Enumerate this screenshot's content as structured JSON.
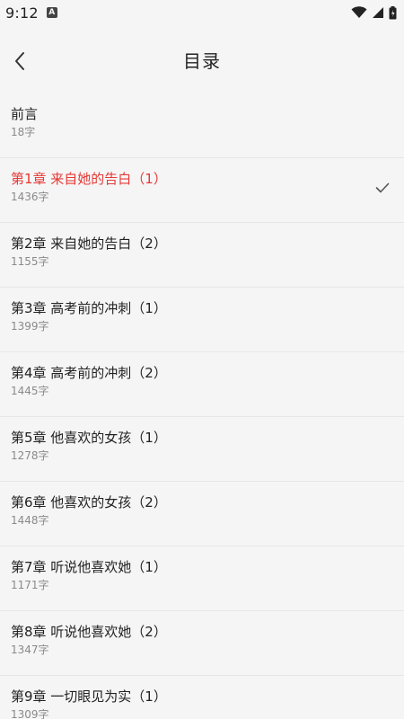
{
  "status_bar": {
    "time": "9:12",
    "notification_icon": "a-notification-icon",
    "icons": [
      "wifi-icon",
      "signal-icon",
      "battery-icon"
    ]
  },
  "header": {
    "back_icon": "back-arrow-icon",
    "title": "目录"
  },
  "colors": {
    "background": "#f5f5f5",
    "current_chapter": "#e53935",
    "secondary_text": "#8a8a8a",
    "divider": "#e6e6e6"
  },
  "chapters": [
    {
      "title": "前言",
      "count": "18字",
      "current": false
    },
    {
      "title": "第1章 来自她的告白（1）",
      "count": "1436字",
      "current": true
    },
    {
      "title": "第2章 来自她的告白（2）",
      "count": "1155字",
      "current": false
    },
    {
      "title": "第3章 高考前的冲刺（1）",
      "count": "1399字",
      "current": false
    },
    {
      "title": "第4章 高考前的冲刺（2）",
      "count": "1445字",
      "current": false
    },
    {
      "title": "第5章 他喜欢的女孩（1）",
      "count": "1278字",
      "current": false
    },
    {
      "title": "第6章 他喜欢的女孩（2）",
      "count": "1448字",
      "current": false
    },
    {
      "title": "第7章 听说他喜欢她（1）",
      "count": "1171字",
      "current": false
    },
    {
      "title": "第8章 听说他喜欢她（2）",
      "count": "1347字",
      "current": false
    },
    {
      "title": "第9章 一切眼见为实（1）",
      "count": "1309字",
      "current": false
    }
  ]
}
